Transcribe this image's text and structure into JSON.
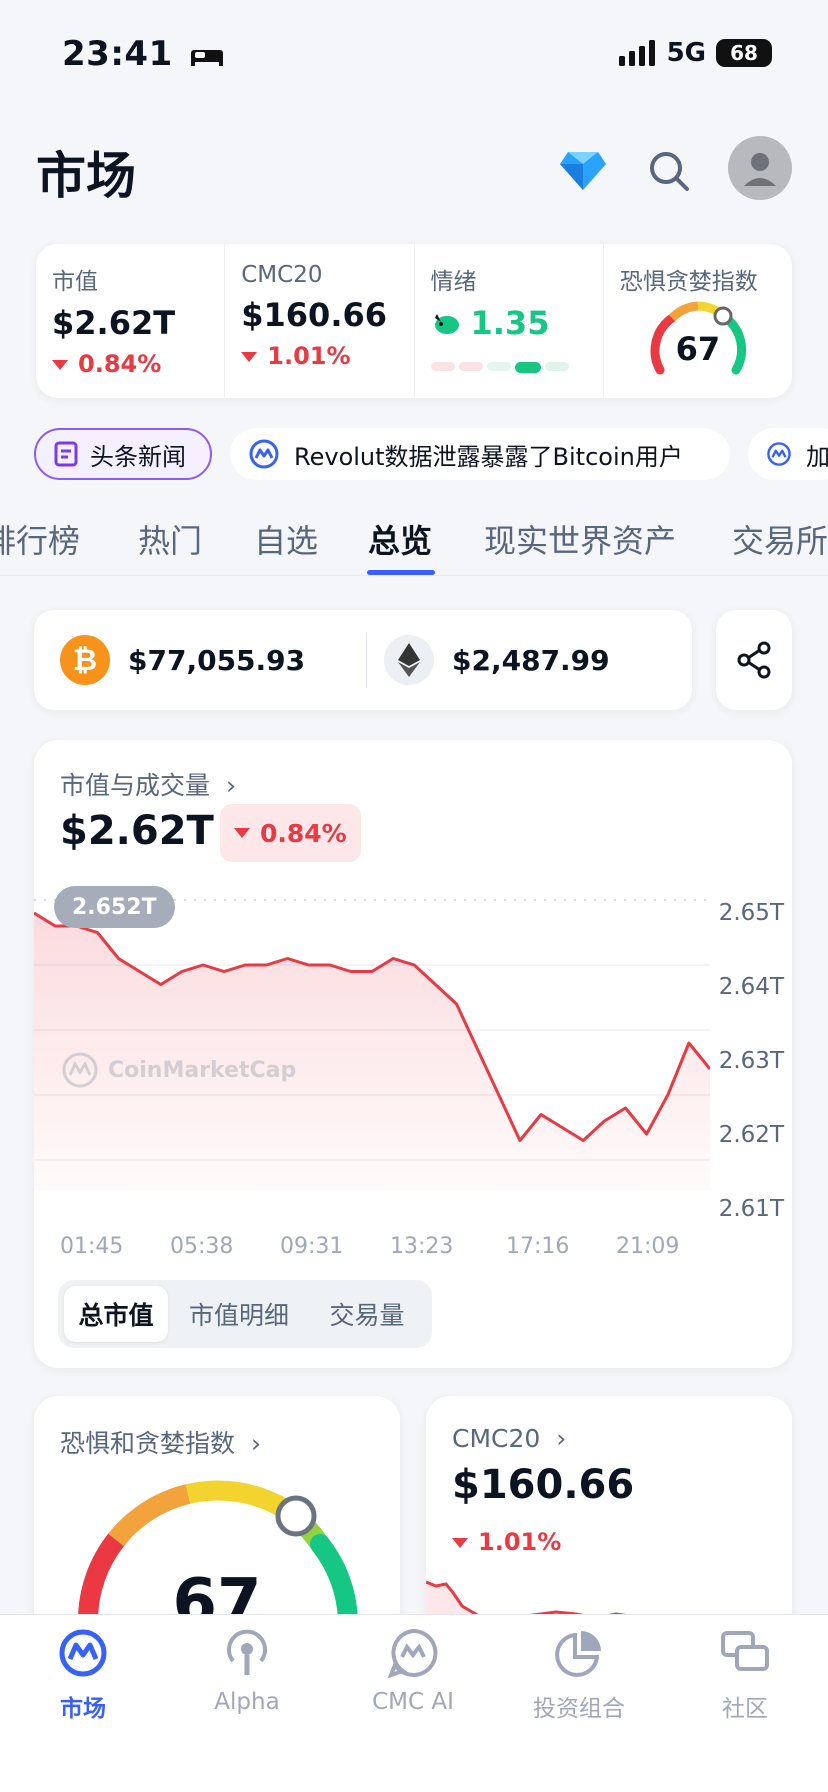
{
  "status_bar": {
    "time": "23:41",
    "network": "5G",
    "battery": "68"
  },
  "header": {
    "title": "市场"
  },
  "metrics": [
    {
      "label": "市值",
      "value": "$2.62T",
      "change": "0.84%"
    },
    {
      "label": "CMC20",
      "value": "$160.66",
      "change": "1.01%"
    },
    {
      "label": "情绪",
      "value": "1.35"
    },
    {
      "label": "恐惧贪婪指数",
      "value": "67"
    }
  ],
  "news": {
    "headline_label": "头条新闻",
    "items": [
      "Revolut数据泄露暴露了Bitcoin用户",
      "加"
    ]
  },
  "tabs": [
    "排行榜",
    "热门",
    "自选",
    "总览",
    "现实世界资产",
    "交易所"
  ],
  "active_tab": "总览",
  "prices": {
    "btc": "$77,055.93",
    "eth": "$2,487.99"
  },
  "market_cap_card": {
    "label": "市值与成交量",
    "value": "$2.62T",
    "change": "0.84%",
    "bubble": "2.652T",
    "watermark": "CoinMarketCap",
    "view_tabs": [
      "总市值",
      "市值明细",
      "交易量"
    ]
  },
  "chart_data": {
    "type": "area",
    "title": "",
    "x_ticks": [
      "01:45",
      "05:38",
      "09:31",
      "13:23",
      "17:16",
      "21:09"
    ],
    "y_ticks": [
      "2.65T",
      "2.64T",
      "2.63T",
      "2.62T",
      "2.61T"
    ],
    "ylim": [
      2.61,
      2.65
    ],
    "values": [
      2.648,
      2.646,
      2.646,
      2.645,
      2.641,
      2.639,
      2.637,
      2.639,
      2.64,
      2.639,
      2.64,
      2.64,
      2.641,
      2.64,
      2.64,
      2.639,
      2.639,
      2.641,
      2.64,
      2.637,
      2.634,
      2.627,
      2.62,
      2.613,
      2.617,
      2.615,
      2.613,
      2.616,
      2.618,
      2.614,
      2.62,
      2.628,
      2.624
    ],
    "color": "#ea3943"
  },
  "fear_greed_card": {
    "label": "恐惧和贪婪指数",
    "value": "67"
  },
  "cmc20_card": {
    "label": "CMC20",
    "value": "$160.66",
    "change": "1.01%"
  },
  "bottom_nav": [
    {
      "label": "市场",
      "icon": "cmc-logo-icon"
    },
    {
      "label": "Alpha",
      "icon": "broadcast-icon"
    },
    {
      "label": "CMC AI",
      "icon": "cmc-ai-icon"
    },
    {
      "label": "投资组合",
      "icon": "pie-chart-icon"
    },
    {
      "label": "社区",
      "icon": "chat-bubbles-icon"
    }
  ],
  "colors": {
    "accent": "#3861fb",
    "down": "#ea3943",
    "up": "#16c784"
  }
}
